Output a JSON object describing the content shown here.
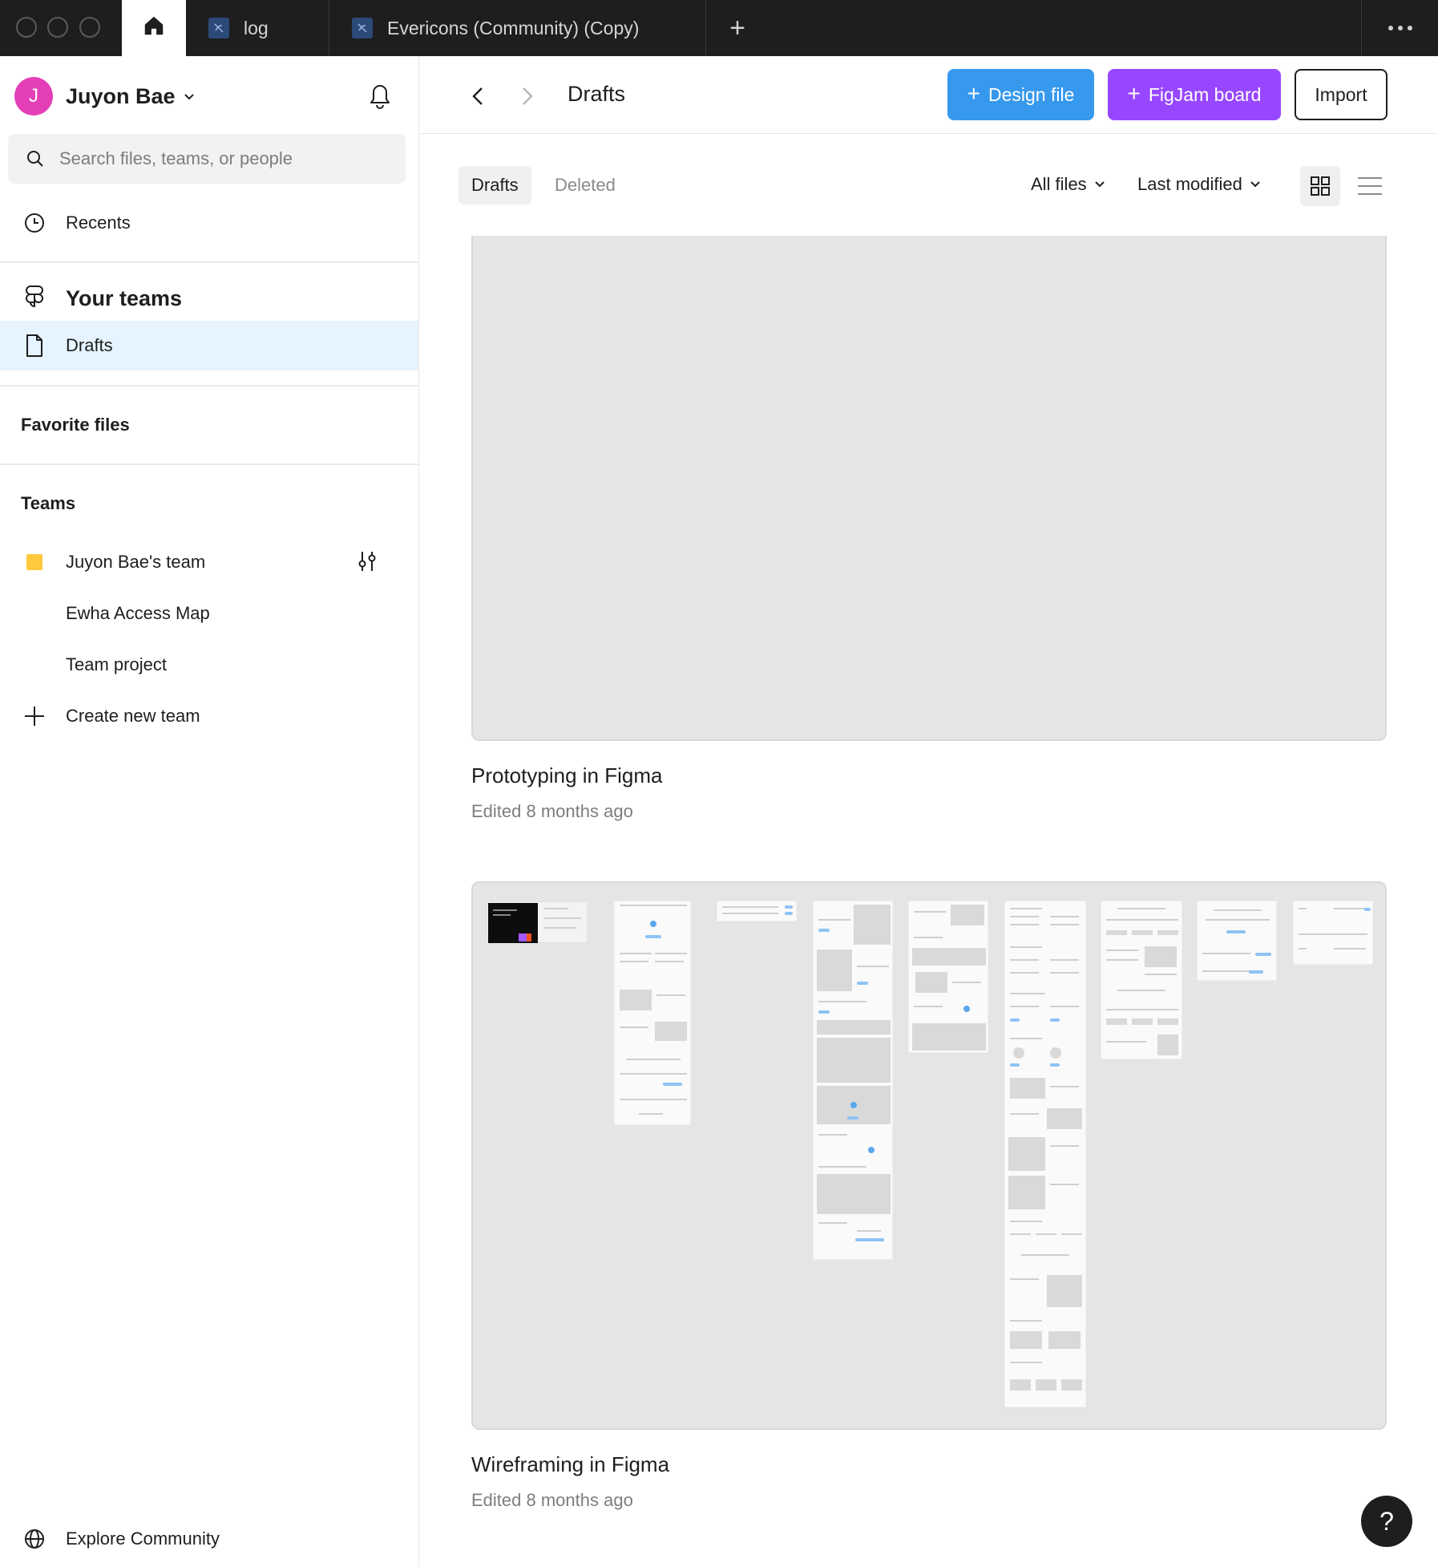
{
  "tabs": {
    "home_label": "",
    "items": [
      {
        "label": "log"
      },
      {
        "label": "Evericons (Community) (Copy)"
      }
    ],
    "new_tab": "+"
  },
  "sidebar": {
    "account_initial": "J",
    "account_name": "Juyon Bae",
    "search_placeholder": "Search files, teams, or people",
    "recents": "Recents",
    "your_teams": "Your teams",
    "drafts": "Drafts",
    "favorite_files": "Favorite files",
    "teams_heading": "Teams",
    "teams": [
      {
        "label": "Juyon Bae's team"
      },
      {
        "label": "Ewha Access Map"
      },
      {
        "label": "Team project"
      }
    ],
    "create_team": "Create new team",
    "explore": "Explore Community"
  },
  "header": {
    "title": "Drafts",
    "design_file": "Design file",
    "figjam_board": "FigJam board",
    "import": "Import"
  },
  "toolbar": {
    "tab_drafts": "Drafts",
    "tab_deleted": "Deleted",
    "filter_files": "All files",
    "sort": "Last modified"
  },
  "files": [
    {
      "title": "Prototyping in Figma",
      "edited": "Edited 8 months ago"
    },
    {
      "title": "Wireframing in Figma",
      "edited": "Edited 8 months ago"
    }
  ],
  "help": "?",
  "colors": {
    "design_button": "#3699ee",
    "figjam_button": "#9747ff",
    "avatar": "#e43fb7",
    "active_nav": "#e5f4ff",
    "team_color": "#ffc83d"
  }
}
